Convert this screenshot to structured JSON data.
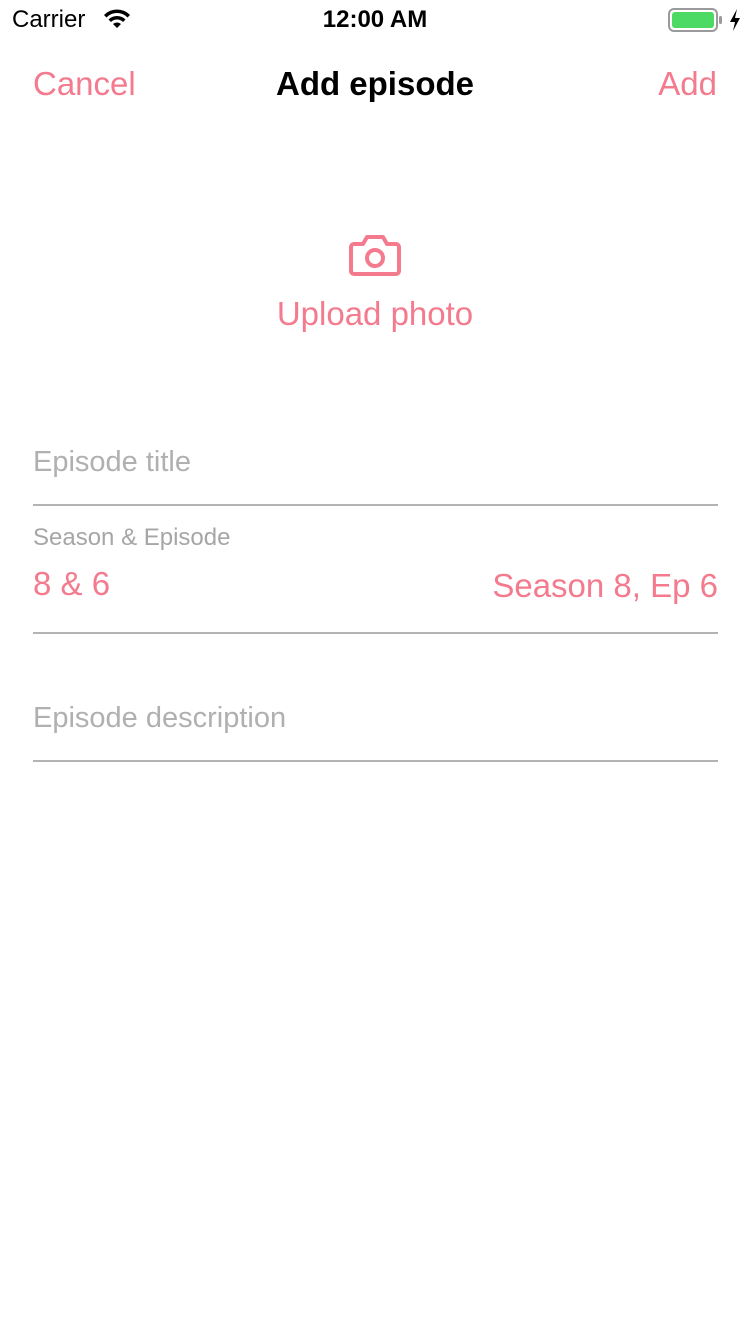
{
  "status_bar": {
    "carrier": "Carrier",
    "time": "12:00 AM",
    "wifi_icon": "wifi-icon",
    "battery_icon": "battery-icon",
    "charging_icon": "charging-bolt-icon",
    "battery_level": 1.0
  },
  "nav": {
    "cancel_label": "Cancel",
    "title": "Add episode",
    "add_label": "Add"
  },
  "upload": {
    "icon": "camera-icon",
    "label": "Upload photo"
  },
  "form": {
    "title_placeholder": "Episode title",
    "season_caption": "Season & Episode",
    "season_value": "8 & 6",
    "season_summary": "Season 8, Ep 6",
    "description_placeholder": "Episode description"
  },
  "colors": {
    "accent": "#f47a8e",
    "placeholder": "#b0b0b0",
    "divider": "#b3b3b3",
    "battery_fill": "#4cd964"
  }
}
